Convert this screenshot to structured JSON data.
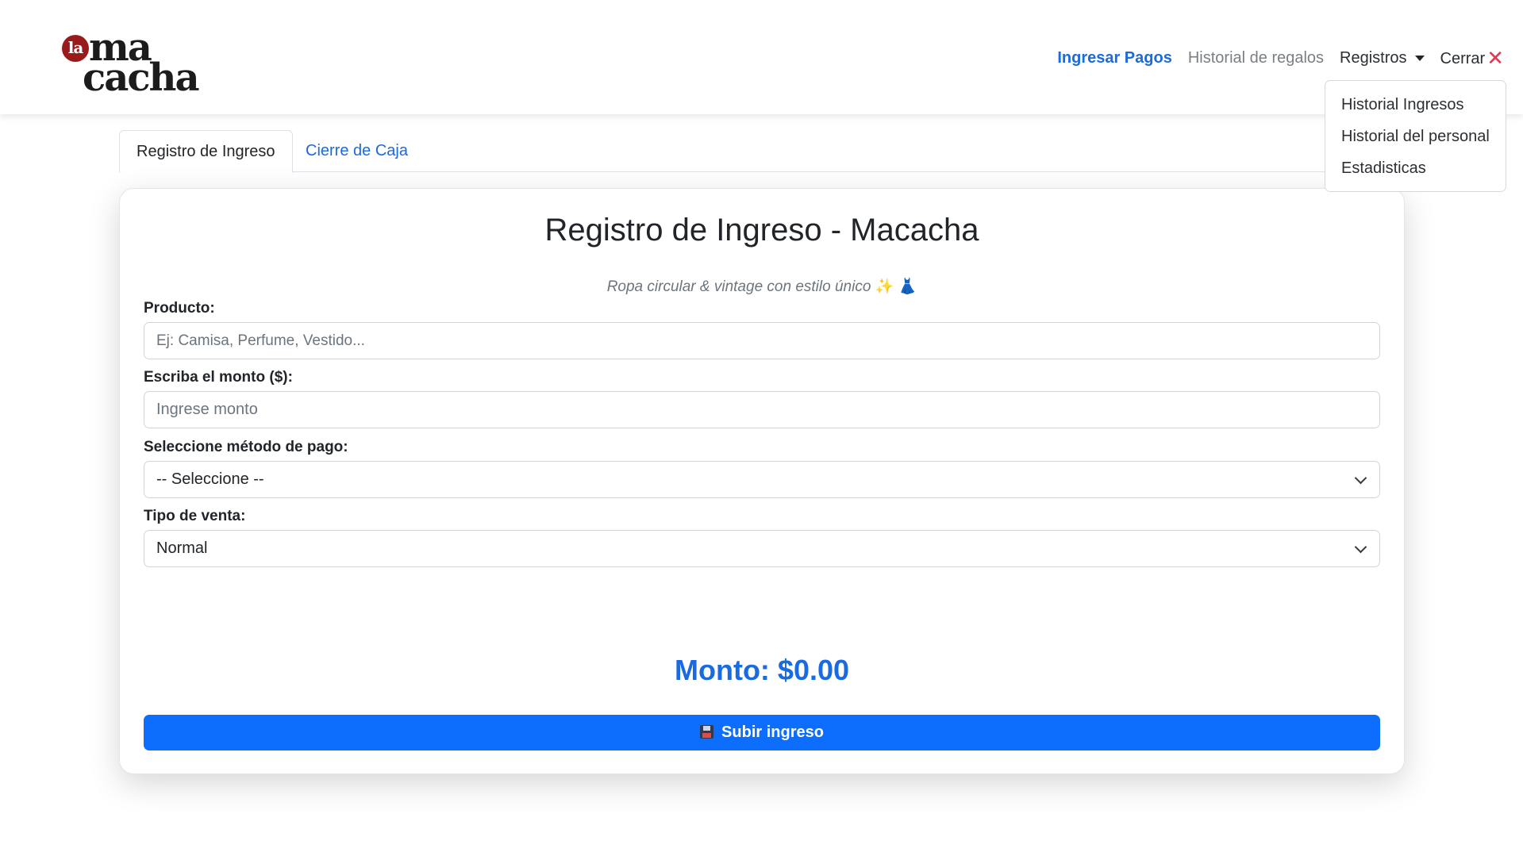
{
  "brand": {
    "badge": "la",
    "line1": "ma",
    "line2": "cacha"
  },
  "nav": {
    "ingresar_pagos": "Ingresar Pagos",
    "historial_regalos": "Historial de regalos",
    "registros": "Registros",
    "cerrar": "Cerrar",
    "close_icon": "✕",
    "dropdown": [
      "Historial Ingresos",
      "Historial del personal",
      "Estadisticas"
    ]
  },
  "tabs": {
    "active": "Registro de Ingreso",
    "inactive": "Cierre de Caja"
  },
  "form": {
    "title": "Registro de Ingreso - Macacha",
    "subtitle": "Ropa circular & vintage con estilo único",
    "sparkle_icon": "✨",
    "dress_icon": "👗",
    "producto_label": "Producto:",
    "producto_placeholder": "Ej: Camisa, Perfume, Vestido...",
    "monto_label": "Escriba el monto ($):",
    "monto_placeholder": "Ingrese monto",
    "metodo_label": "Seleccione método de pago:",
    "metodo_value": "-- Seleccione --",
    "tipo_label": "Tipo de venta:",
    "tipo_value": "Normal",
    "monto_total": "Monto: $0.00",
    "submit_label": "Subir ingreso"
  },
  "colors": {
    "primary": "#0d6efd",
    "link": "#1a6ae0",
    "close": "#e8344e",
    "brand_red": "#9a1b1b"
  }
}
